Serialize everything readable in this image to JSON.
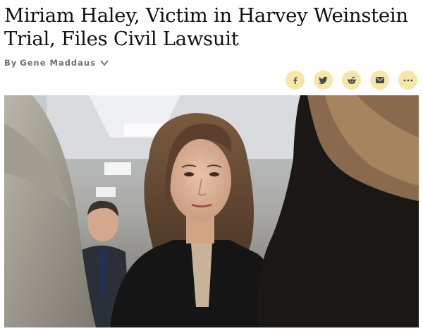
{
  "article": {
    "headline": "Miriam Haley, Victim in Harvey Weinstein Trial, Files Civil Lawsuit",
    "byline_prefix": "By",
    "author": "Gene Maddaus"
  },
  "share": {
    "buttons": [
      {
        "icon": "facebook-icon"
      },
      {
        "icon": "twitter-icon"
      },
      {
        "icon": "reddit-icon"
      },
      {
        "icon": "email-icon"
      },
      {
        "icon": "more-icon"
      }
    ],
    "accent": "#f5e6a9",
    "icon_color": "#4a4a4a"
  }
}
